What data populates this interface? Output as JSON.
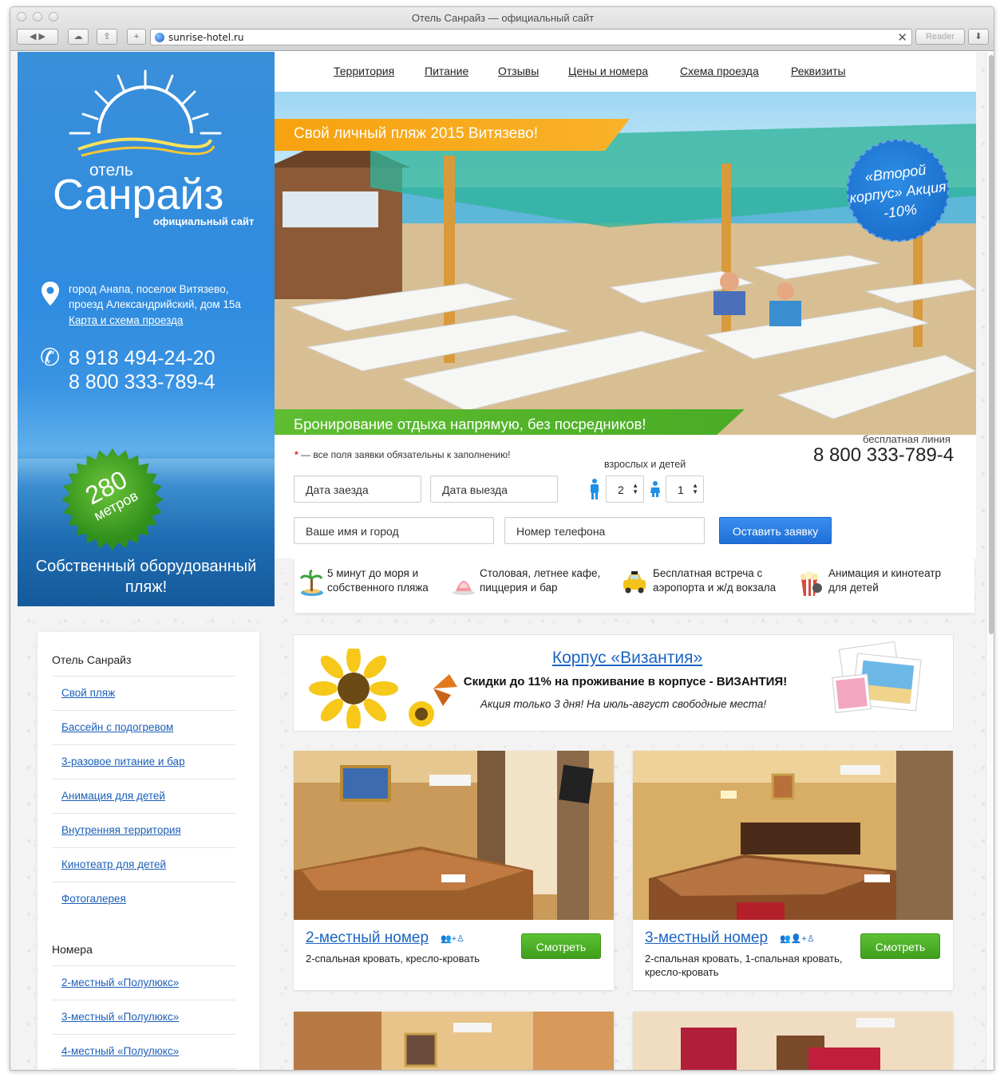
{
  "browser": {
    "window_title": "Отель Санрайз — официальный сайт",
    "url": "sunrise-hotel.ru",
    "reader_label": "Reader"
  },
  "header": {
    "logo_small": "отель",
    "logo_big": "Санрайз",
    "logo_sub": "официальный сайт",
    "address": "город Анапа, поселок Витязево, проезд Александрийский, дом 15а",
    "map_link": "Карта и схема проезда",
    "phone1": "8 918 494-24-20",
    "phone2": "8 800 333-789-4",
    "badge_number": "280",
    "badge_unit": "метров",
    "beach_text": "Собственный оборудованный пляж!"
  },
  "nav": {
    "items": [
      {
        "label": "Территория"
      },
      {
        "label": "Питание"
      },
      {
        "label": "Отзывы"
      },
      {
        "label": "Цены и номера"
      },
      {
        "label": "Схема проезда"
      },
      {
        "label": "Реквизиты"
      }
    ]
  },
  "hero": {
    "orange_banner": "Свой личный пляж 2015 Витязево!",
    "circle_text": "«Второй корпус» Акция -10%",
    "green_banner": "Бронирование отдыха напрямую, без посредников!"
  },
  "booking": {
    "required_note_star": "*",
    "required_note": " — все поля заявки обязательны к заполнению!",
    "free_line_label": "бесплатная линия",
    "free_line_phone": "8 800 333-789-4",
    "guests_label": "взрослых и детей",
    "checkin_placeholder": "Дата заезда",
    "checkout_placeholder": "Дата выезда",
    "adults_value": "2",
    "children_value": "1",
    "name_placeholder": "Ваше имя и город",
    "phone_placeholder": "Номер телефона",
    "submit_label": "Оставить заявку"
  },
  "features": [
    {
      "text": "5 минут до моря и собственного пляжа"
    },
    {
      "text": "Столовая, летнее кафе, пиццерия и бар"
    },
    {
      "text": "Бесплатная встреча с аэропорта и ж/д вокзала"
    },
    {
      "text": "Анимация и кинотеатр для детей"
    }
  ],
  "sidebar": {
    "section1_title": "Отель Санрайз",
    "section1_links": [
      "Свой пляж",
      "Бассейн с подогревом",
      "3-разовое питание и бар",
      "Анимация для детей",
      "Внутренняя территория",
      "Кинотеатр для детей",
      "Фотогалерея"
    ],
    "section2_title": "Номера",
    "section2_links": [
      "2-местный «Полулюкс»",
      "3-местный «Полулюкс»",
      "4-местный «Полулюкс»"
    ]
  },
  "promo": {
    "title": "Корпус «Византия»",
    "line1": "Скидки до 11% на проживание в корпусе - ВИЗАНТИЯ!",
    "line2": "Акция только 3 дня! На июль-август свободные места!"
  },
  "rooms": [
    {
      "title": "2-местный номер",
      "people": "👥+♙",
      "desc": "2-спальная кровать, кресло-кровать",
      "button": "Смотреть"
    },
    {
      "title": "3-местный номер",
      "people": "👥👤+♙",
      "desc": "2-спальная кровать, 1-спальная кровать, кресло-кровать",
      "button": "Смотреть"
    }
  ],
  "colors": {
    "panel_blue": "#2f8ce0",
    "accent_orange": "#f7a20f",
    "accent_green": "#5ebd31",
    "link_blue": "#1b64c4",
    "button_blue": "#2a7de4",
    "button_green": "#4cae24"
  }
}
